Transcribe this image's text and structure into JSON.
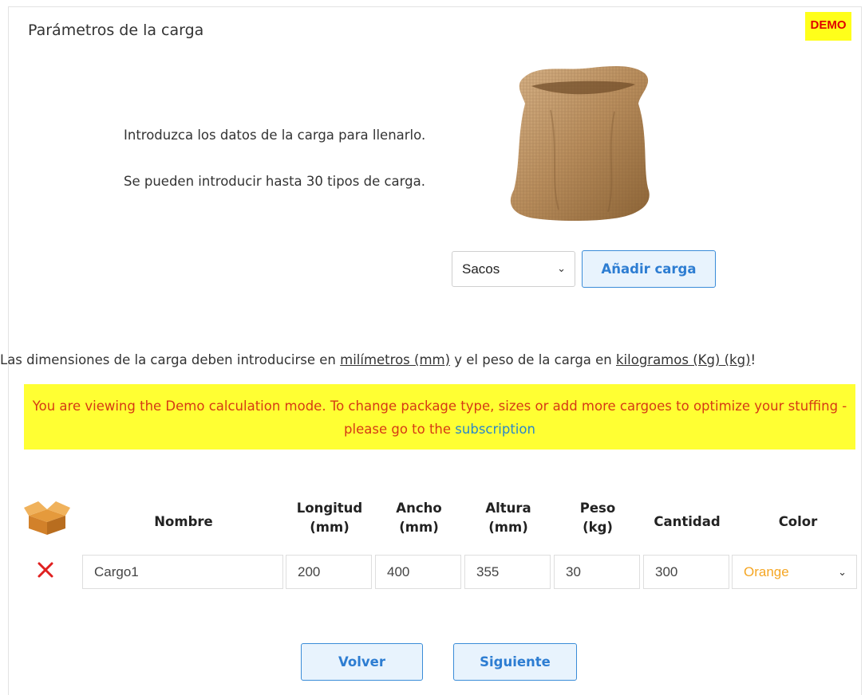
{
  "panel": {
    "title": "Parámetros de la carga",
    "badge": "DEMO"
  },
  "intro": {
    "line1": "Introduzca los datos de la carga para llenarlo.",
    "line2": "Se pueden introducir hasta 30 tipos de carga."
  },
  "cargo_type": {
    "selected": "Sacos",
    "add_button": "Añadir carga"
  },
  "units_note": {
    "part1": "Las dimensiones de la carga deben introducirse en ",
    "length_unit": "milímetros (mm)",
    "part2": " y el peso de la carga en ",
    "weight_unit": "kilogramos (Kg) (kg)",
    "part3": "!"
  },
  "demo_notice": {
    "text": "You are viewing the Demo calculation mode. To change package type, sizes or add more cargoes to optimize your stuffing - please go to the ",
    "link": "subscription"
  },
  "table": {
    "headers": {
      "name": "Nombre",
      "length": [
        "Longitud",
        "(mm)"
      ],
      "width": [
        "Ancho",
        "(mm)"
      ],
      "height": [
        "Altura",
        "(mm)"
      ],
      "weight": [
        "Peso",
        "(kg)"
      ],
      "quantity": "Cantidad",
      "color": "Color"
    },
    "rows": [
      {
        "name": "Cargo1",
        "length": "200",
        "width": "400",
        "height": "355",
        "weight": "30",
        "quantity": "300",
        "color": "Orange"
      }
    ]
  },
  "colors": {
    "accent": "#2d7dd2",
    "demo_bg": "#ffff33",
    "demo_text": "#d63a14",
    "delete": "#e02020",
    "orange": "#f5a623"
  },
  "icons": {
    "box": "open-box-icon",
    "delete": "close-icon",
    "dropdown": "chevron-down-icon"
  },
  "nav": {
    "back": "Volver",
    "next": "Siguiente"
  }
}
